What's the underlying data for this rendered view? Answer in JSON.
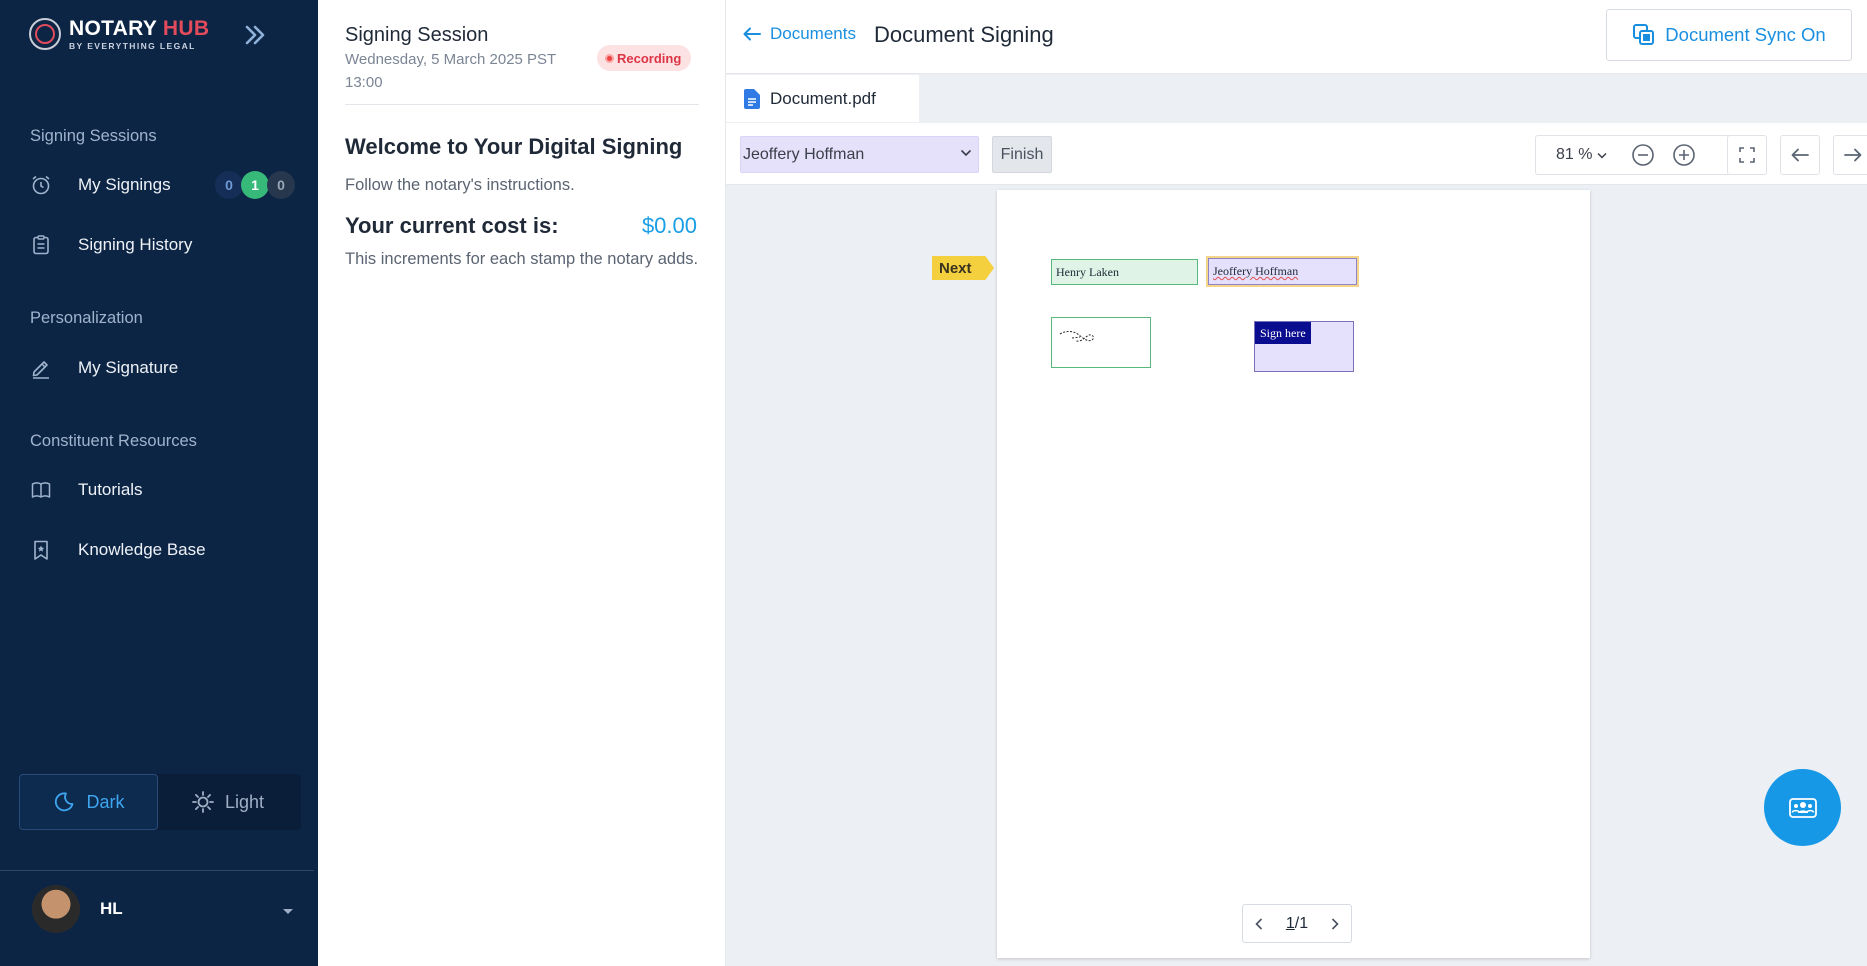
{
  "app": {
    "brand_main": "NOTARY",
    "brand_accent": "HUB",
    "brand_sub": "BY EVERYTHING LEGAL",
    "accent_color": "#1a8fe0",
    "sidebar_color": "#0d2545"
  },
  "sidebar": {
    "sections": [
      {
        "heading": "Signing Sessions"
      },
      {
        "heading": "Personalization"
      },
      {
        "heading": "Constituent Resources"
      }
    ],
    "items": [
      {
        "label": "My Signings",
        "icon": "alarm-clock-icon"
      },
      {
        "label": "Signing History",
        "icon": "clipboard-icon"
      },
      {
        "label": "My Signature",
        "icon": "pen-icon"
      },
      {
        "label": "Tutorials",
        "icon": "book-icon"
      },
      {
        "label": "Knowledge Base",
        "icon": "bookmark-icon"
      }
    ],
    "signing_counts": [
      "0",
      "1",
      "0"
    ],
    "theme": {
      "dark": "Dark",
      "light": "Light",
      "selected": "Dark"
    },
    "user": {
      "initials": "HL"
    }
  },
  "session": {
    "title": "Signing Session",
    "date": "Wednesday, 5 March 2025   PST 13:00",
    "status": "Recording",
    "welcome": "Welcome to Your Digital Signing",
    "instructions": "Follow the notary's instructions.",
    "cost_label": "Your current cost is:",
    "cost_value": "$0.00",
    "cost_note": "This increments for each stamp the notary adds."
  },
  "main": {
    "back_label": "Documents",
    "title": "Document Signing",
    "sync_label": "Document Sync On",
    "tab_label": "Document.pdf",
    "signer_selected": "Jeoffery Hoffman",
    "finish_label": "Finish",
    "zoom": "81 %",
    "next_label": "Next",
    "fields": {
      "henry_name": "Henry Laken",
      "jeoffery_name": "Jeoffery Hoffman",
      "sign_here": "Sign here"
    },
    "pager": {
      "current": "1",
      "separator": "/",
      "total": "1"
    }
  }
}
